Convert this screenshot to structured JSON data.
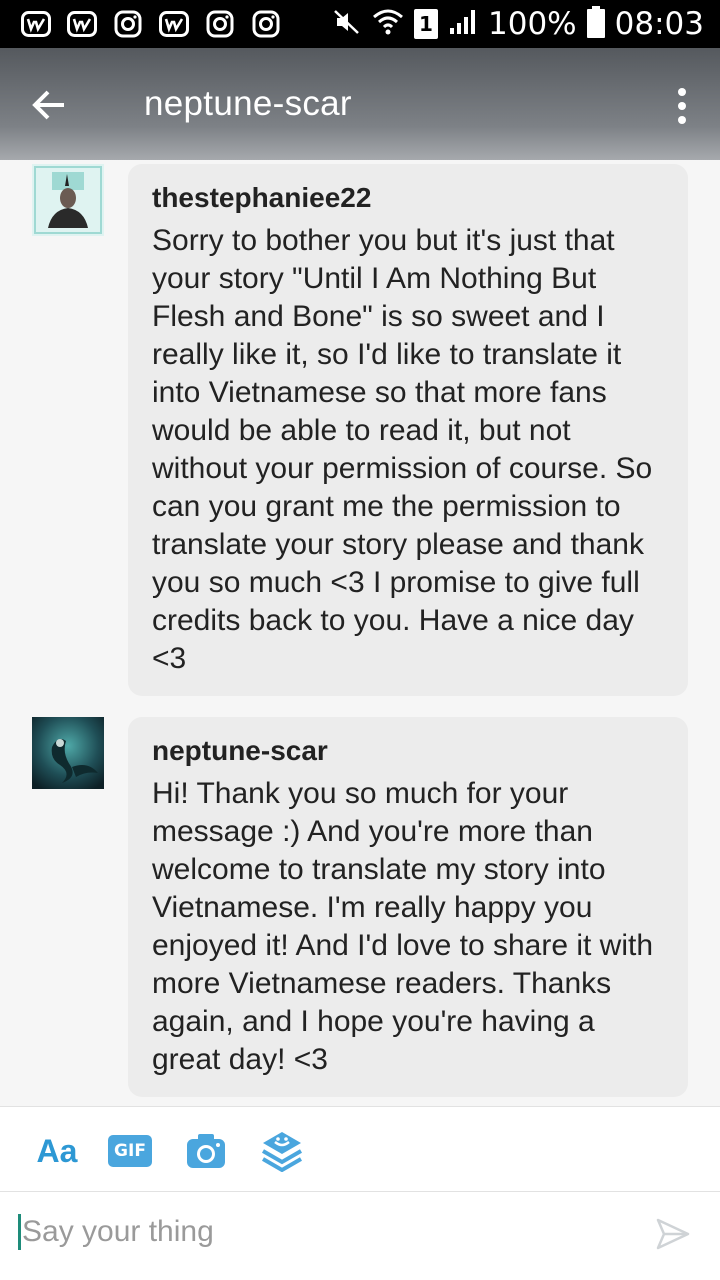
{
  "status_bar": {
    "notification_icons": [
      "w-app-icon",
      "w-app-icon",
      "instagram-icon",
      "w-app-icon",
      "instagram-icon",
      "instagram-icon"
    ],
    "sim": "1",
    "battery_percent": "100%",
    "time": "08:03"
  },
  "header": {
    "title": "neptune-scar"
  },
  "messages": [
    {
      "author": "thestephaniee22",
      "text": "Sorry to bother you but it's just that your story \"Until I Am Nothing But Flesh and Bone\" is so sweet and I really like it, so I'd like to translate it into Vietnamese so that more fans would be able to read it, but not without your permission of course. So can you grant me the permission to translate your story please and thank you so much <3 I promise to give full credits back to you. Have a nice day <3"
    },
    {
      "author": "neptune-scar",
      "text": "Hi! Thank you so much for your message :) And you're more than welcome to translate my story into Vietnamese. I'm really happy you enjoyed it! And I'd love to share it with more Vietnamese readers. Thanks again, and I hope you're having a great day! <3"
    }
  ],
  "toolbar": {
    "font_label": "Aa",
    "gif_label": "GIF"
  },
  "compose": {
    "placeholder": "Say your thing"
  },
  "colors": {
    "accent": "#2d98d4",
    "bubble": "#ececec",
    "background": "#f6f6f6"
  }
}
